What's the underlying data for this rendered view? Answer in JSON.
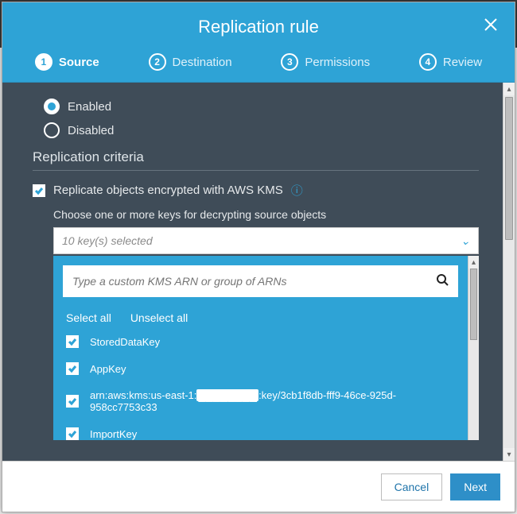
{
  "modal": {
    "title": "Replication rule",
    "steps": [
      {
        "num": "1",
        "label": "Source",
        "active": true
      },
      {
        "num": "2",
        "label": "Destination",
        "active": false
      },
      {
        "num": "3",
        "label": "Permissions",
        "active": false
      },
      {
        "num": "4",
        "label": "Review",
        "active": false
      }
    ]
  },
  "status": {
    "enabled_label": "Enabled",
    "disabled_label": "Disabled",
    "selected": "enabled"
  },
  "criteria": {
    "section_title": "Replication criteria",
    "kms_checkbox_label": "Replicate objects encrypted with AWS KMS",
    "kms_checked": true,
    "choose_keys_label": "Choose one or more keys for decrypting source objects",
    "select_summary": "10 key(s) selected",
    "search_placeholder": "Type a custom KMS ARN or group of ARNs",
    "select_all": "Select all",
    "unselect_all": "Unselect all",
    "keys": [
      {
        "label": "StoredDataKey",
        "checked": true
      },
      {
        "label": "AppKey",
        "checked": true
      },
      {
        "label": "arn:aws:kms:us-east-1:",
        "redacted": "████████",
        "suffix": ":key/3cb1f8db-fff9-46ce-925d-958cc7753c33",
        "checked": true
      },
      {
        "label": "ImportKey",
        "checked": true
      }
    ]
  },
  "footer": {
    "cancel": "Cancel",
    "next": "Next"
  }
}
